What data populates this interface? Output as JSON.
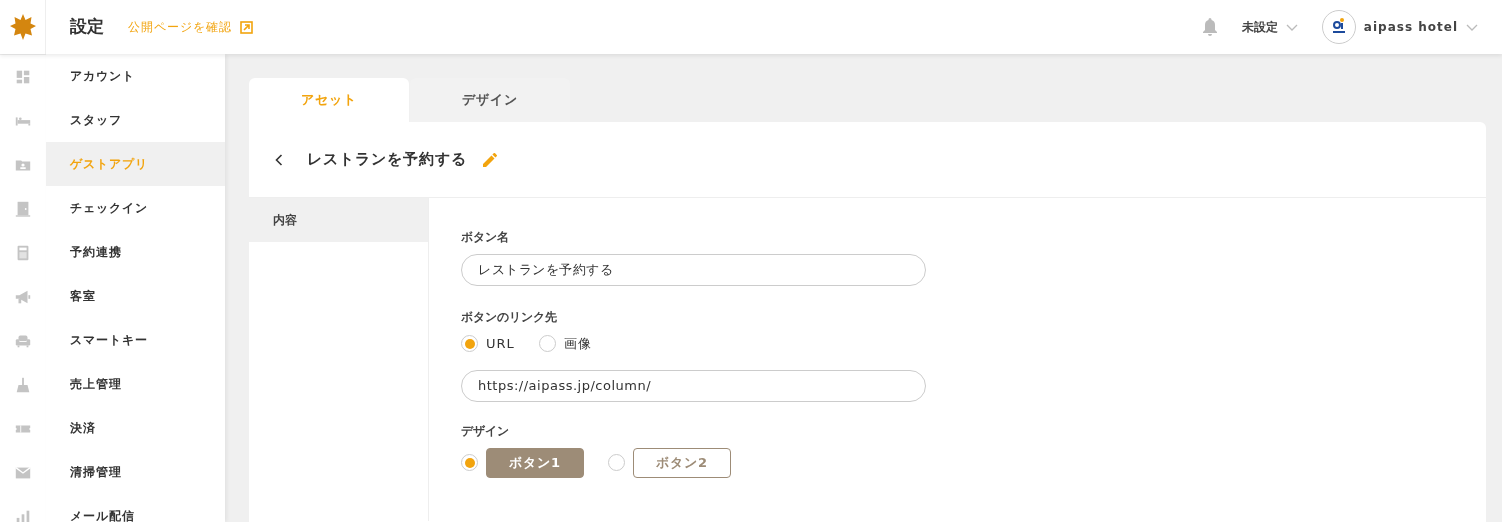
{
  "header": {
    "title": "設定",
    "public_link": "公開ページを確認",
    "facility": "未設定",
    "account": "aipass hotel"
  },
  "sidebar": {
    "items": [
      {
        "label": "アカウント",
        "selected": false
      },
      {
        "label": "スタッフ",
        "selected": false
      },
      {
        "label": "ゲストアプリ",
        "selected": true
      },
      {
        "label": "チェックイン",
        "selected": false
      },
      {
        "label": "予約連携",
        "selected": false
      },
      {
        "label": "客室",
        "selected": false
      },
      {
        "label": "スマートキー",
        "selected": false
      },
      {
        "label": "売上管理",
        "selected": false
      },
      {
        "label": "決済",
        "selected": false
      },
      {
        "label": "清掃管理",
        "selected": false
      },
      {
        "label": "メール配信",
        "selected": false
      }
    ]
  },
  "tabs": [
    {
      "label": "アセット",
      "selected": true
    },
    {
      "label": "デザイン",
      "selected": false
    }
  ],
  "page": {
    "title": "レストランを予約する",
    "subnav": [
      {
        "label": "内容",
        "selected": true
      }
    ],
    "form": {
      "name_label": "ボタン名",
      "name_value": "レストランを予約する",
      "link_label": "ボタンのリンク先",
      "link_options": [
        {
          "label": "URL",
          "selected": true
        },
        {
          "label": "画像",
          "selected": false
        }
      ],
      "url_value": "https://aipass.jp/column/",
      "design_label": "デザイン",
      "design_options": [
        {
          "label": "ボタン1",
          "selected": true,
          "kind": "filled"
        },
        {
          "label": "ボタン2",
          "selected": false,
          "kind": "outline"
        }
      ]
    }
  }
}
